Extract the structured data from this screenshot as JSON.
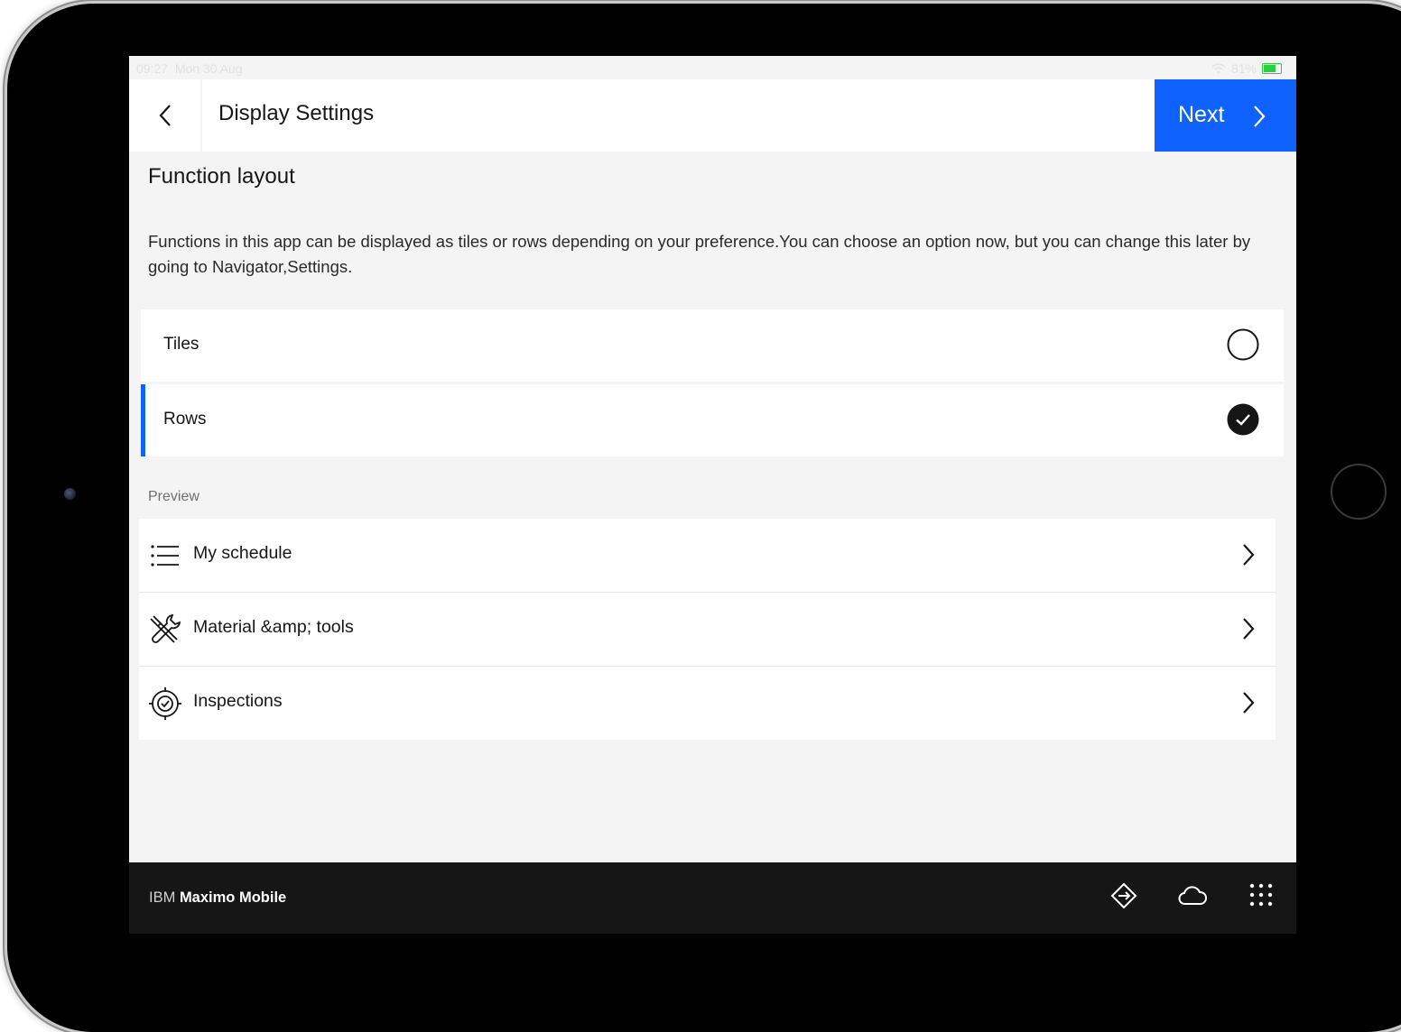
{
  "statusbar": {
    "time": "09:27",
    "date": "Mon 30 Aug",
    "battery": "81%"
  },
  "header": {
    "title": "Display Settings",
    "next_label": "Next"
  },
  "section": {
    "title": "Function layout",
    "description": "Functions in this app can be displayed as tiles or rows depending on your preference.You can choose an option now, but you can change this later by going to Navigator,Settings."
  },
  "options": [
    {
      "label": "Tiles",
      "selected": false
    },
    {
      "label": "Rows",
      "selected": true
    }
  ],
  "preview": {
    "label": "Preview",
    "items": [
      {
        "label": "My schedule",
        "icon": "list-icon"
      },
      {
        "label": "Material &amp; tools",
        "icon": "tools-icon"
      },
      {
        "label": "Inspections",
        "icon": "inspection-icon"
      }
    ]
  },
  "footer": {
    "brand_prefix": "IBM",
    "brand_name": "Maximo Mobile",
    "icons": [
      "navigation-diamond-icon",
      "cloud-icon",
      "app-grid-icon"
    ]
  },
  "colors": {
    "accent": "#0f62fe",
    "footer_bg": "#161616",
    "screen_bg": "#f4f4f4"
  }
}
